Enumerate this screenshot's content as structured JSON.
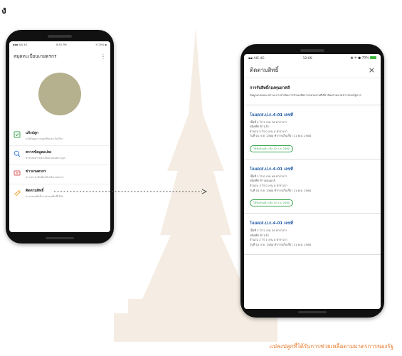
{
  "page": {
    "top_glyph": "ง",
    "caption": "แปลงปลูกที่ได้รับการช่วยเหลือตามมาตรการของรัฐ"
  },
  "left_phone": {
    "status_bar": {
      "carrier": "▪▪▪ AIS 4G",
      "time": "8:51 PM",
      "battery": "✈ 25% ▪"
    },
    "app_title": "สมุดทะเบียนเกษตรกร",
    "menu_icon": "⋮",
    "menu": [
      {
        "icon": "checklist-icon",
        "title": "แจ้งปลูก",
        "subtitle": "แจ้งข้อมูลการปลูกพืชและเก็บเกี่ยว"
      },
      {
        "icon": "search-icon",
        "title": "ตรวจข้อมูลแปลง",
        "subtitle": "ตรวจสอบรายละเอียดแปลงเพาะปลูก"
      },
      {
        "icon": "news-icon",
        "title": "ข่าวเกษตรกร",
        "subtitle": "ข่าวประชาสัมพันธ์สำหรับเกษตรกร"
      },
      {
        "icon": "rights-icon",
        "title": "ติดตามสิทธิ์",
        "subtitle": "ตรวจสอบสิทธิ์การช่วยเหลือที่ได้รับ"
      }
    ]
  },
  "right_phone": {
    "status_bar": {
      "carrier": "▪▪ AIS 4G",
      "time": "12:00",
      "battery": "◉ ✈ ● 70%"
    },
    "title": "ติดตามสิทธิ์",
    "close": "×",
    "intro": {
      "title": "การรับสิทธิ์กองทุนยาคลี",
      "description": "ข้อมูลแปลงและสถานะการดำเนินการช่วยเหลือจากหน่วยงานที่เกี่ยวข้องตามมาตรการของรัฐบาล"
    },
    "cards": [
      {
        "title": "โฉนด/ส.ป.ก.4-01 เลขที่",
        "lines": [
          "เนื้อที่ 4 ไร่ 3 งาน 78 ตารางวา",
          "ชนิดพืช ข้าวเจ้า",
          "จำนวน 5 ไร่ 0 งาน 0 ตารางวา",
          "วันที่ 01 ก.ค. 2560 ทำการเก็บเกี่ยว 11 พ.ย. 2560"
        ],
        "badge": "ได้รับเงินแล้ว เมื่อ 12 ก.ย. 2560"
      },
      {
        "title": "โฉนด/ส.ป.ก.4-01 เลขที่",
        "lines": [
          "เนื้อที่ 3 ไร่ 0 งาน 48 ตารางวา",
          "ชนิดพืช ข้าวหอมมะลิ",
          "จำนวน 3 ไร่ 0 งาน 0 ตารางวา",
          "วันที่ 01 ก.ค. 2560 ทำการเก็บเกี่ยว 11 พ.ย. 2560"
        ],
        "badge": "ได้รับเงินแล้ว เมื่อ 12 ก.ย. 2560"
      },
      {
        "title": "โฉนด/ส.ป.ก.4-01 เลขที่",
        "lines": [
          "เนื้อที่ 2 ไร่ 2 งาน 29 ตารางวา",
          "ชนิดพืช ข้าวเจ้า",
          "จำนวน 2 ไร่ 1 งาน 0 ตารางวา",
          "วันที่ 01 ก.ค. 2560 ทำการเก็บเกี่ยว 11 พ.ย. 2560"
        ]
      }
    ]
  },
  "colors": {
    "avatar": "#b5b08e",
    "link_blue": "#1e5aa8",
    "badge_green": "#3aa64c",
    "caption_orange": "#e87a2a",
    "icon_green": "#3aa64c",
    "icon_blue": "#3b7dd8",
    "icon_red": "#e05a5a",
    "icon_orange": "#f0a030"
  }
}
